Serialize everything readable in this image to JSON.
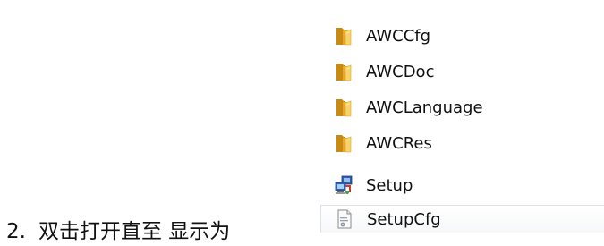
{
  "caption": {
    "number": "2.",
    "text": "双击打开直至 显示为"
  },
  "files": [
    {
      "name": "AWCCfg",
      "icon": "folder-icon"
    },
    {
      "name": "AWCDoc",
      "icon": "folder-icon"
    },
    {
      "name": "AWCLanguage",
      "icon": "folder-icon"
    },
    {
      "name": "AWCRes",
      "icon": "folder-icon"
    },
    {
      "name": "Setup",
      "icon": "setup-installer-icon"
    },
    {
      "name": "SetupCfg",
      "icon": "config-file-icon"
    }
  ],
  "colors": {
    "folder_back": "#d49a1e",
    "folder_front": "#f6cf5a",
    "installer_blue": "#2f5fb0"
  }
}
